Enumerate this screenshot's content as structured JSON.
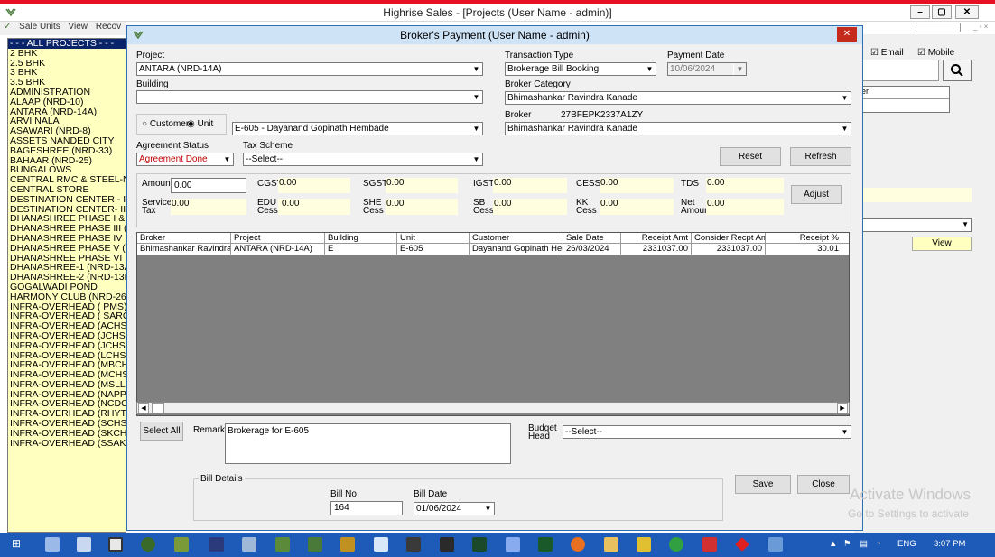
{
  "app": {
    "title": "Highrise Sales - [Projects (User Name - admin)]",
    "menu": [
      "Sale Units",
      "View",
      "Recov"
    ],
    "min_label": "–",
    "max_label": "▢",
    "close_label": "✕"
  },
  "projects": [
    "- - - ALL PROJECTS - - -",
    "2 BHK",
    "2.5 BHK",
    "3 BHK",
    "3.5 BHK",
    "ADMINISTRATION",
    "ALAAP (NRD-10)",
    "ANTARA (NRD-14A)",
    "ARVI NALA",
    "ASAWARI (NRD-8)",
    "ASSETS NANDED CITY",
    "BAGESHREE (NRD-33)",
    "BAHAAR (NRD-25)",
    "BUNGALOWS",
    "CENTRAL RMC & STEEL-N",
    "CENTRAL STORE",
    "DESTINATION CENTER - I",
    "DESTINATION CENTER- II",
    "DHANASHREE PHASE I &",
    "DHANASHREE PHASE III (",
    "DHANASHREE PHASE IV",
    "DHANASHREE PHASE V (",
    "DHANASHREE PHASE VI",
    "DHANASHREE-1 (NRD-13A",
    "DHANASHREE-2 (NRD-13B",
    "GOGALWADI POND",
    "HARMONY CLUB (NRD-26A",
    "INFRA-OVERHEAD ( PMS)",
    "INFRA-OVERHEAD ( SARC",
    "INFRA-OVERHEAD (ACHS",
    "INFRA-OVERHEAD (JCHSI",
    "INFRA-OVERHEAD (JCHSI",
    "INFRA-OVERHEAD (LCHS",
    "INFRA-OVERHEAD (MBCH",
    "INFRA-OVERHEAD (MCHS",
    "INFRA-OVERHEAD (MSLL",
    "INFRA-OVERHEAD (NAPP",
    "INFRA-OVERHEAD (NCDC",
    "INFRA-OVERHEAD (RHYT",
    "INFRA-OVERHEAD (SCHS",
    "INFRA-OVERHEAD (SKCH",
    "INFRA-OVERHEAD (SSAK"
  ],
  "right_panel": {
    "email_label": "Email",
    "mobile_label": "Mobile",
    "search_icon": "search-icon",
    "col_label": "er",
    "view_label": "View"
  },
  "dialog": {
    "title": "Broker's Payment (User Name - admin)",
    "close_label": "✕",
    "project_label": "Project",
    "project_value": "ANTARA (NRD-14A)",
    "building_label": "Building",
    "building_value": "",
    "transaction_type_label": "Transaction Type",
    "transaction_type_value": "Brokerage Bill Booking",
    "payment_date_label": "Payment Date",
    "payment_date_value": "10/06/2024",
    "broker_category_label": "Broker Category",
    "broker_category_value": "Bhimashankar Ravindra Kanade",
    "broker_label": "Broker",
    "broker_code": "27BFEPK2337A1ZY",
    "broker_value": "Bhimashankar Ravindra Kanade",
    "customer_radio": "Customer",
    "unit_radio": "Unit",
    "unit_value": "E-605 - Dayanand Gopinath Hembade",
    "agreement_status_label": "Agreement Status",
    "agreement_status_value": "Agreement Done",
    "tax_scheme_label": "Tax Scheme",
    "tax_scheme_value": "--Select--",
    "reset_label": "Reset",
    "refresh_label": "Refresh",
    "amount_label": "Amount",
    "amount_value": "0.00",
    "cgst_label": "CGST",
    "cgst_value": "0.00",
    "sgst_label": "SGST",
    "sgst_value": "0.00",
    "igst_label": "IGST",
    "igst_value": "0.00",
    "cess_label": "CESS",
    "cess_value": "0.00",
    "tds_label": "TDS",
    "tds_value": "0.00",
    "service_tax_label1": "Service",
    "service_tax_label2": "Tax",
    "service_tax_value": "0.00",
    "edu_label1": "EDU",
    "edu_label2": "Cess",
    "edu_value": "0.00",
    "she_label1": "SHE",
    "she_label2": "Cess",
    "she_value": "0.00",
    "sb_label1": "SB",
    "sb_label2": "Cess",
    "sb_value": "0.00",
    "kk_label1": "KK",
    "kk_label2": "Cess",
    "kk_value": "0.00",
    "net_label1": "Net",
    "net_label2": "Amount",
    "net_value": "0.00",
    "adjust_label": "Adjust",
    "grid_headers": [
      "Broker",
      "Project",
      "Building",
      "Unit",
      "Customer",
      "Sale Date",
      "Receipt Amt",
      "Consider Recpt Amt",
      "Receipt %"
    ],
    "grid_rows": [
      [
        "Bhimashankar Ravindra Ka",
        "ANTARA (NRD-14A)",
        "E",
        "E-605",
        "Dayanand Gopinath Hemb",
        "26/03/2024",
        "2331037.00",
        "2331037.00",
        "30.01"
      ]
    ],
    "select_all_label": "Select All",
    "remark_label": "Remark",
    "remark_value": "Brokerage for E-605",
    "budget_head_label1": "Budget",
    "budget_head_label2": "Head",
    "budget_head_value": "--Select--",
    "bill_details_label": "Bill Details",
    "bill_no_label": "Bill No",
    "bill_no_value": "164",
    "bill_date_label": "Bill Date",
    "bill_date_value": "01/06/2024",
    "save_label": "Save",
    "close_btn_label": "Close"
  },
  "watermark": {
    "line1": "Activate Windows",
    "line2": "Go to Settings to activate"
  },
  "taskbar": {
    "lang": "ENG",
    "time": "3:07 PM"
  }
}
